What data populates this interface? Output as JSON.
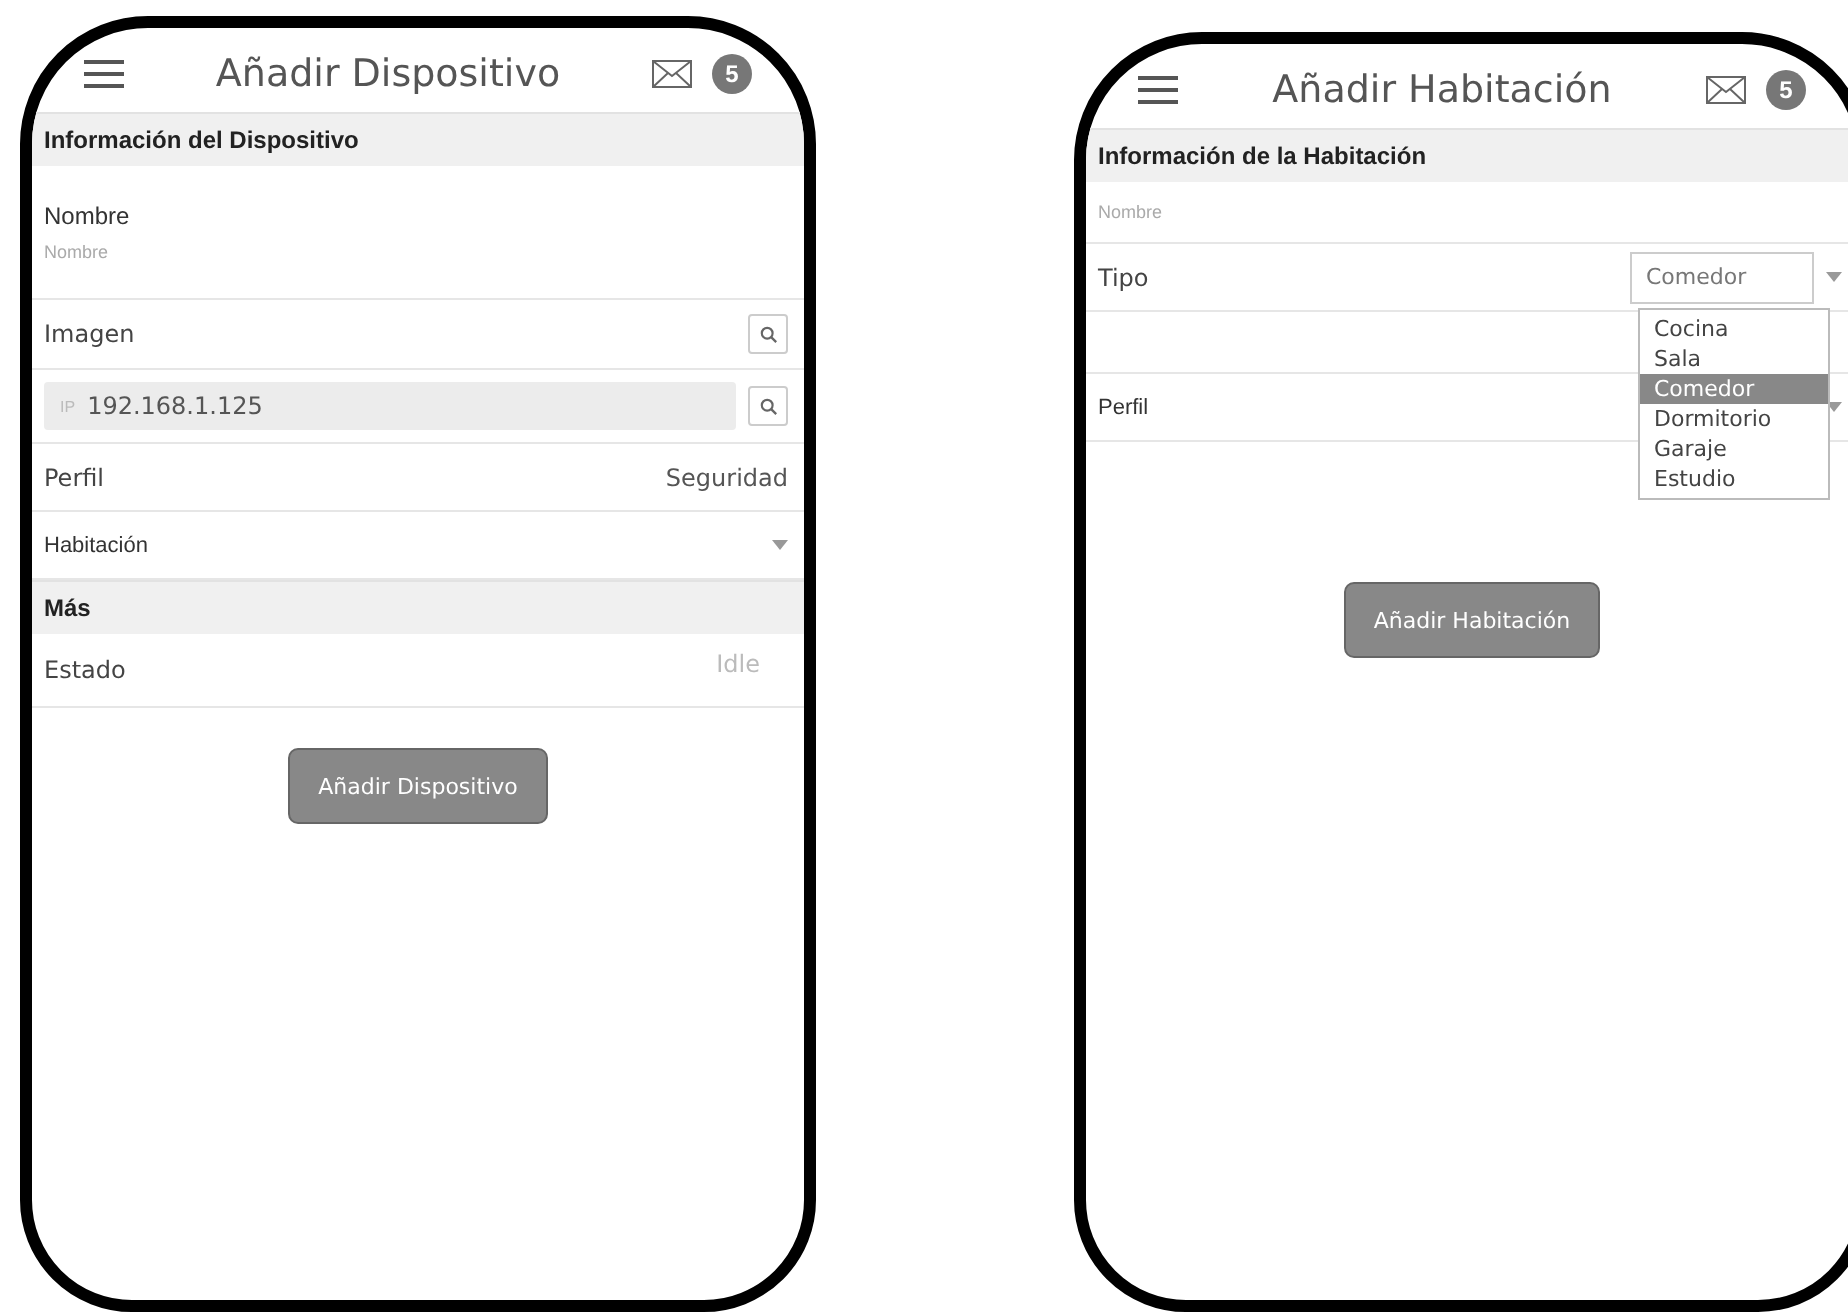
{
  "screens": [
    {
      "title": "Añadir Dispositivo",
      "badge": "5",
      "button": "Añadir Dispositivo",
      "rows": [
        {
          "kind": "section",
          "label": "Información del Dispositivo"
        },
        {
          "kind": "stacked",
          "label": "Nombre",
          "placeholder": "Nombre"
        },
        {
          "kind": "search",
          "label": "Imagen"
        },
        {
          "kind": "ip",
          "prefix": "IP",
          "value": "192.168.1.125"
        },
        {
          "kind": "value",
          "label": "Perfil",
          "value": "Seguridad",
          "disabled": false
        },
        {
          "kind": "select",
          "value": "Habitación"
        },
        {
          "kind": "section",
          "label": "Más"
        },
        {
          "kind": "value",
          "label": "Estado",
          "value": "Idle",
          "disabled": true
        }
      ]
    },
    {
      "title": "Añadir Habitación",
      "badge": "5",
      "button": "Añadir Habitación",
      "rows": [
        {
          "kind": "section",
          "label": "Información de la Habitación"
        },
        {
          "kind": "input",
          "placeholder": "Nombre"
        },
        {
          "kind": "dropdown",
          "label": "Tipo",
          "value": "Comedor",
          "expanded": true,
          "options": [
            {
              "label": "Cocina",
              "selected": false
            },
            {
              "label": "Sala",
              "selected": false
            },
            {
              "label": "Comedor",
              "selected": true
            },
            {
              "label": "Dormitorio",
              "selected": false
            },
            {
              "label": "Garaje",
              "selected": false
            },
            {
              "label": "Estudio",
              "selected": false
            }
          ]
        },
        {
          "kind": "blank"
        },
        {
          "kind": "select",
          "value": "Perfil"
        }
      ]
    }
  ]
}
